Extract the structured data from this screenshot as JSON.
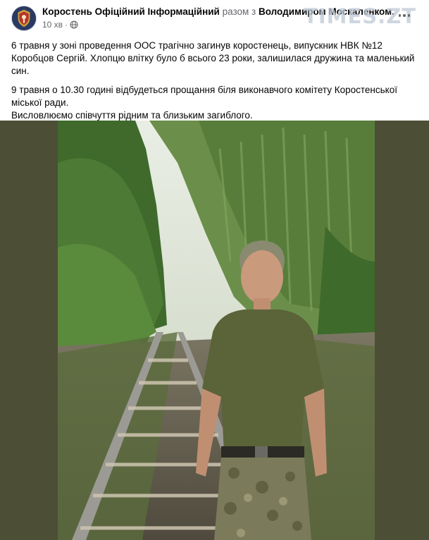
{
  "post": {
    "page_name": "Коростень Офіційний Інформаційний",
    "with_word": "разом з",
    "co_author": "Володимиром Москаленком.",
    "time": "10 хв",
    "dot": "·",
    "privacy_icon": "globe-icon",
    "more_icon": "more-options-icon",
    "watermark": "TIMES.ZT",
    "paragraph_1": "6 травня у зоні проведення ООС трагічно загинув коростенець, випускник НВК №12 Коробцов Сергій. Хлопцю влітку було б всього 23 роки, залишилася дружина та маленький син.",
    "paragraph_2_line_1": "9 травня о 10.30 годині відбудеться прощання біля виконавчого комітету Коростенської міської ради.",
    "paragraph_2_line_2": "Висловлюємо співчуття рідним та близьким загиблого."
  },
  "colors": {
    "photo_background": "#4c4e36",
    "secondary_text": "#65676b",
    "primary_text": "#050505"
  }
}
